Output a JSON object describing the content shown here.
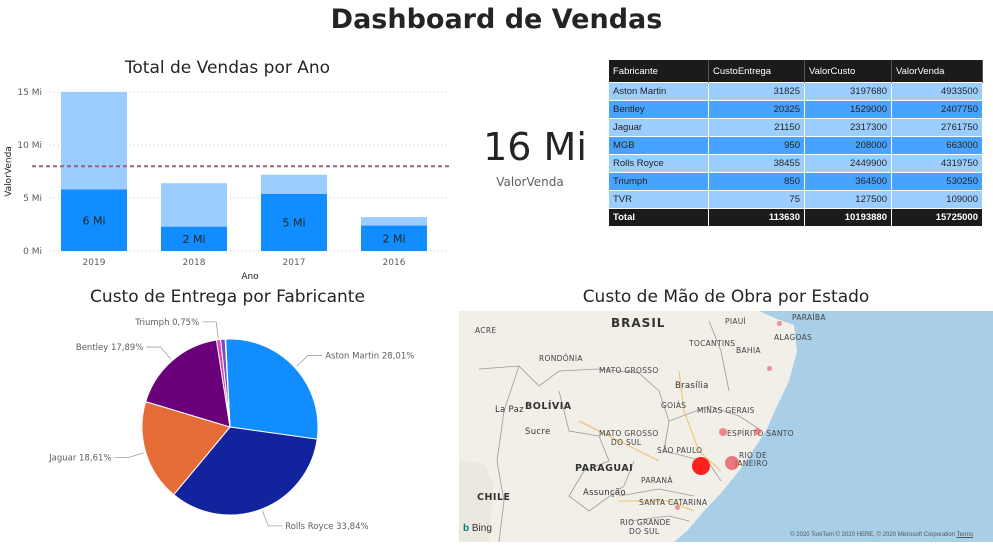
{
  "dashboard": {
    "title": "Dashboard de Vendas"
  },
  "bar_chart_title": "Total de Vendas por Ano",
  "kpi": {
    "value": "16 Mi",
    "label": "ValorVenda"
  },
  "table": {
    "headers": [
      "Fabricante",
      "CustoEntrega",
      "ValorCusto",
      "ValorVenda"
    ],
    "rows": [
      [
        "Aston Martin",
        "31825",
        "3197680",
        "4933500"
      ],
      [
        "Bentley",
        "20325",
        "1529000",
        "2407750"
      ],
      [
        "Jaguar",
        "21150",
        "2317300",
        "2761750"
      ],
      [
        "MGB",
        "950",
        "208000",
        "663000"
      ],
      [
        "Rolls Royce",
        "38455",
        "2449900",
        "4319750"
      ],
      [
        "Triumph",
        "850",
        "364500",
        "530250"
      ],
      [
        "TVR",
        "75",
        "127500",
        "109000"
      ]
    ],
    "total": [
      "Total",
      "113630",
      "10193880",
      "15725000"
    ]
  },
  "pie_chart_title": "Custo de Entrega por Fabricante",
  "map": {
    "title": "Custo de Mão de Obra por Estado",
    "labels": {
      "brasil": "BRASIL",
      "bolivia": "BOLÍVIA",
      "paraguai": "PARAGUAI",
      "chile": "CHILE",
      "acre": "ACRE",
      "rondonia": "RONDÔNIA",
      "mato_grosso": "MATO GROSSO",
      "goias": "GOIÁS",
      "minas": "MINAS GERAIS",
      "espirito": "ESPÍRITO SANTO",
      "rio1": "RIO DE",
      "rio2": "JANEIRO",
      "sao_paulo": "SÃO PAULO",
      "ms1": "MATO GROSSO",
      "ms2": "DO SUL",
      "parana": "PARANÁ",
      "sc": "SANTA CATARINA",
      "rs1": "RIO GRANDE",
      "rs2": "DO SUL",
      "piaui": "PIAUÍ",
      "paraiba": "PARAÍBA",
      "alagoas": "ALAGOAS",
      "tocantins": "TOCANTINS",
      "bahia": "BAHIA",
      "brasilia": "Brasília",
      "lapaz": "La Paz",
      "sucre": "Sucre",
      "assuncao": "Assunção"
    },
    "logo": "Bing",
    "copyright": "© 2020 TomTom © 2020 HERE, © 2020 Microsoft Corporation",
    "terms": "Terms"
  },
  "chart_data": [
    {
      "type": "bar",
      "title": "Total de Vendas por Ano",
      "xlabel": "Ano",
      "ylabel": "ValorVenda",
      "categories": [
        "2019",
        "2018",
        "2017",
        "2016"
      ],
      "series": [
        {
          "values": [
            5.8,
            2.3,
            5.4,
            2.4
          ],
          "color": "#118dff"
        },
        {
          "values": [
            9.2,
            4.1,
            1.8,
            0.8
          ],
          "color": "#9ccdff"
        }
      ],
      "data_labels": [
        "6 Mi",
        "2 Mi",
        "5 Mi",
        "2 Mi"
      ],
      "y_ticks": [
        "0 Mi",
        "5 Mi",
        "10 Mi",
        "15 Mi"
      ],
      "ylim": [
        0,
        15
      ],
      "reference_line": 8,
      "stacked": true
    },
    {
      "type": "pie",
      "title": "Custo de Entrega por Fabricante",
      "slices": [
        {
          "label": "Aston Martin 28,01%",
          "value": 28.01,
          "color": "#118dff"
        },
        {
          "label": "Rolls Royce 33,84%",
          "value": 33.84,
          "color": "#12239e"
        },
        {
          "label": "Jaguar 18,61%",
          "value": 18.61,
          "color": "#e66c37"
        },
        {
          "label": "Bentley 17,89%",
          "value": 17.89,
          "color": "#6b007b"
        },
        {
          "label": "Triumph 0,75%",
          "value": 0.75,
          "color": "#e044a7"
        },
        {
          "label": "",
          "value": 0.84,
          "color": "#744ec2"
        },
        {
          "label": "",
          "value": 0.07,
          "color": "#d9b300"
        }
      ]
    }
  ]
}
